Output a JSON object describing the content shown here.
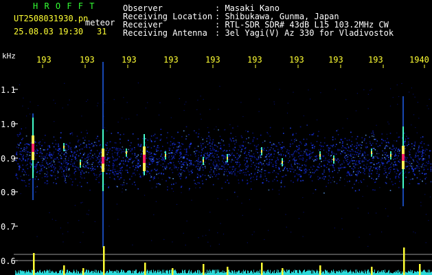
{
  "header": {
    "app_name": "H R O F F T",
    "filename": "UT2508031930.pn",
    "filename_suffix": "meteor",
    "datetime": "25.08.03 19:30",
    "frame_number": "31"
  },
  "info": {
    "labels": [
      "Observer",
      "Receiving Location",
      "Receiver",
      "Receiving Antenna"
    ],
    "values": [
      ": Masaki Kano",
      ": Shibukawa, Gunma, Japan",
      ": RTL-SDR SDR# 43dB L15 103.2MHz CW",
      ": 3el Yagi(V) Az 330 for Vladivostok"
    ]
  },
  "axes": {
    "y_unit": "kHz",
    "y_ticks": [
      "1.1",
      "1.0",
      "0.9",
      "0.8",
      "0.7",
      "0.6"
    ],
    "x_ticks": [
      "193",
      "193",
      "193",
      "193",
      "193",
      "193",
      "193",
      "193",
      "193",
      "1940"
    ]
  },
  "colors": {
    "background": "#000000",
    "title_green": "#33ff33",
    "axis_yellow": "#ffff33",
    "noise_blue": "#2244ff",
    "baseline_cyan": "#33ffff"
  }
}
